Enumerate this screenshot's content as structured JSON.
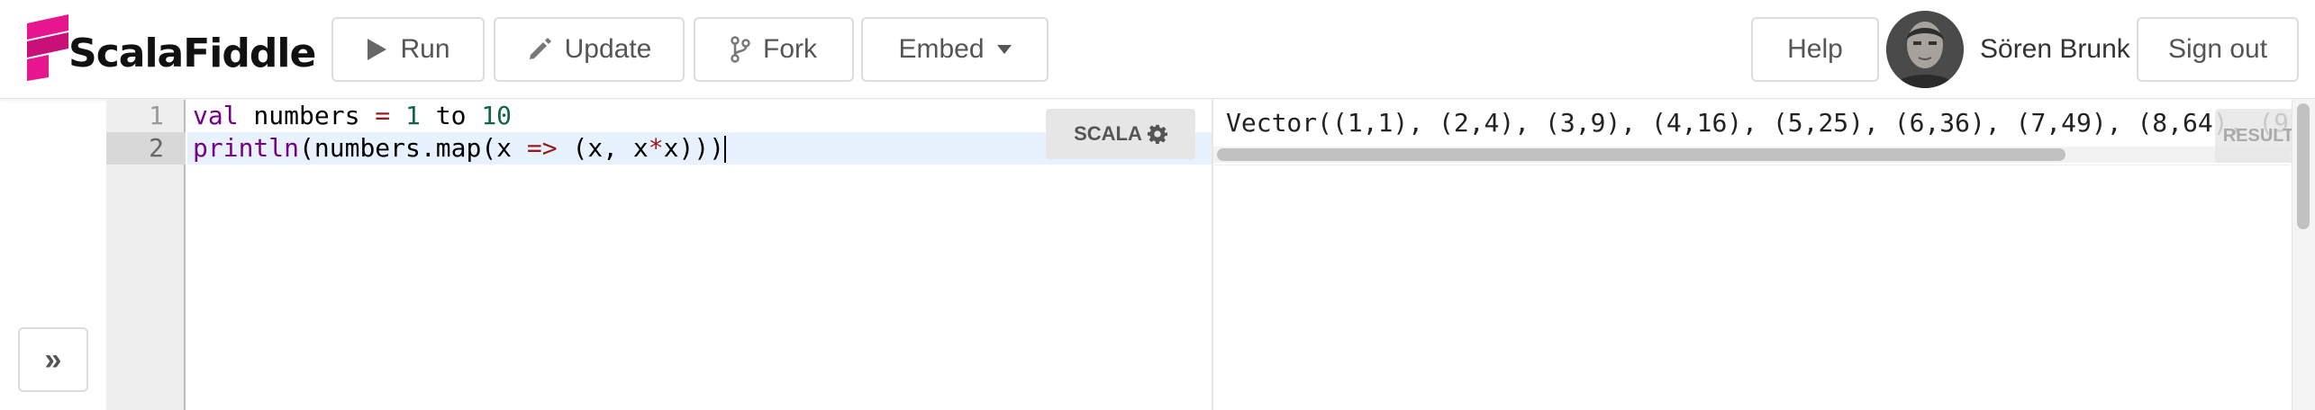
{
  "app": {
    "logo_text": "ScalaFiddle",
    "brand_color": "#e8168e"
  },
  "toolbar": {
    "run_label": "Run",
    "update_label": "Update",
    "fork_label": "Fork",
    "embed_label": "Embed",
    "help_label": "Help",
    "user_name": "Sören Brunk",
    "signout_label": "Sign out"
  },
  "icons": {
    "run": "play-icon",
    "update": "pencil-icon",
    "fork": "branch-icon",
    "embed": "caret-down-icon",
    "language": "gear-icon",
    "collapse": "double-chevron-right-icon"
  },
  "editor": {
    "language_label": "SCALA",
    "active_line": 2,
    "lines": [
      {
        "number": "1",
        "tokens": {
          "kw": "val",
          "name": " numbers ",
          "op": "=",
          "sp1": " ",
          "n1": "1",
          "mid": " to ",
          "n2": "10"
        }
      },
      {
        "number": "2",
        "text": "println(numbers.map(x => (x, x*x)))"
      }
    ]
  },
  "result": {
    "output": "Vector((1,1), (2,4), (3,9), (4,16), (5,25), (6,36), (7,49), (8,64), (9",
    "badge_label": "RESULT"
  },
  "collapse_label": "»"
}
